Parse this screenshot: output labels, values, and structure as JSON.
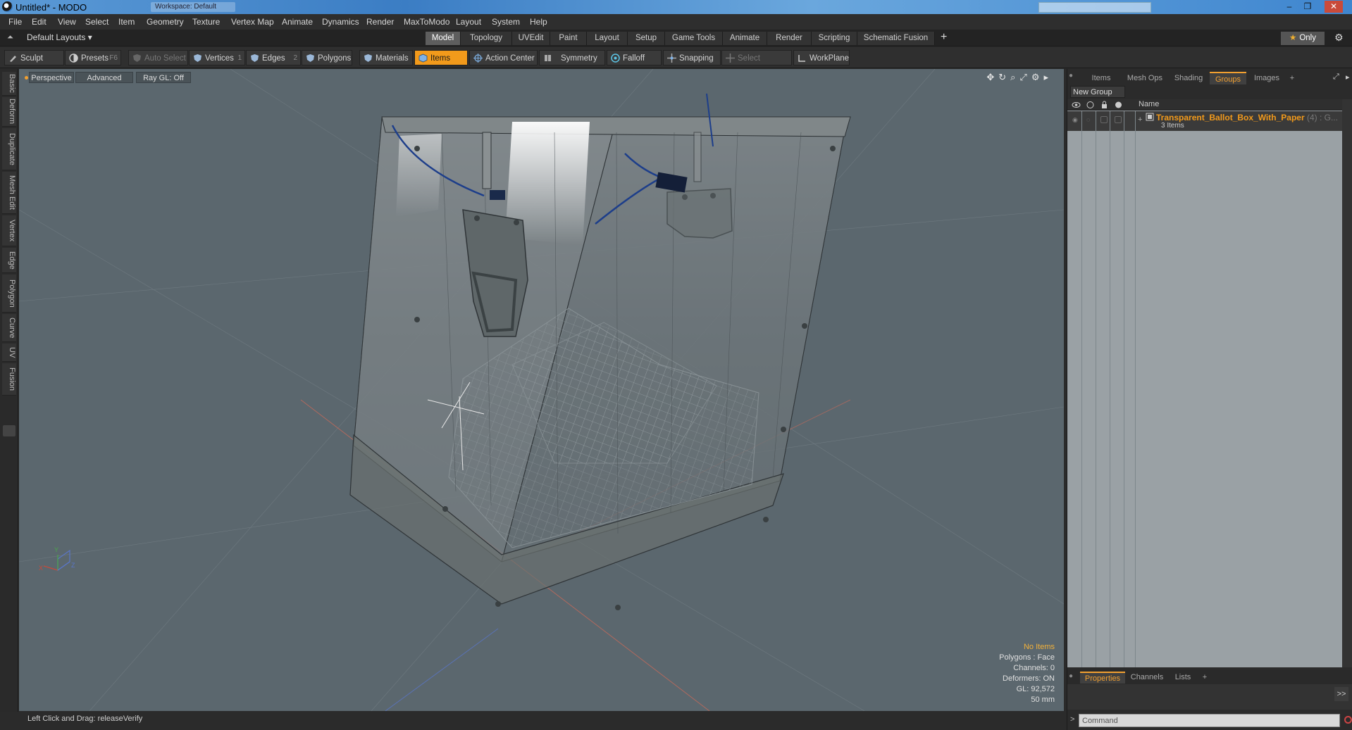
{
  "window": {
    "title": "Untitled* - MODO",
    "ghost_tabs": [
      "Workspace: Default"
    ],
    "controls": [
      "–",
      "❐",
      "✕"
    ]
  },
  "menu": [
    "File",
    "Edit",
    "View",
    "Select",
    "Item",
    "Geometry",
    "Texture",
    "Vertex Map",
    "Animate",
    "Dynamics",
    "Render",
    "MaxToModo",
    "Layout",
    "System",
    "Help"
  ],
  "layouts": {
    "dropdown": "Default Layouts ▾",
    "tabs": [
      "Model",
      "Topology",
      "UVEdit",
      "Paint",
      "Layout",
      "Setup",
      "Game Tools",
      "Animate",
      "Render",
      "Scripting",
      "Schematic Fusion"
    ],
    "active_tab": "Model",
    "add": "+",
    "only_label": "Only"
  },
  "toolbar": {
    "sculpt": "Sculpt",
    "presets": "Presets",
    "presets_key": "F6",
    "auto_select": "Auto Select",
    "vertices": "Vertices",
    "vertices_key": "1",
    "edges": "Edges",
    "edges_key": "2",
    "polygons": "Polygons",
    "materials": "Materials",
    "items": "Items",
    "action_center": "Action Center",
    "symmetry": "Symmetry",
    "falloff": "Falloff",
    "snapping": "Snapping",
    "select_through": "Select Through",
    "workplane": "WorkPlane"
  },
  "left_tabs": [
    "Basic",
    "Deform",
    "Duplicate",
    "Mesh Edit",
    "Vertex",
    "Edge",
    "Polygon",
    "Curve",
    "UV",
    "Fusion"
  ],
  "viewport": {
    "view_mode": "Perspective",
    "shading": "Advanced",
    "raygl": "Ray GL: Off",
    "info": {
      "no_items": "No Items",
      "polygons": "Polygons : Face",
      "channels": "Channels: 0",
      "deformers": "Deformers: ON",
      "gl": "GL: 92,572",
      "unit": "50 mm"
    },
    "axis_labels": [
      "X",
      "Y",
      "Z"
    ]
  },
  "status": {
    "hint": "Left Click and Drag:   releaseVerify"
  },
  "right_panel": {
    "tabs": [
      "Items",
      "Mesh Ops",
      "Shading",
      "Groups",
      "Images"
    ],
    "active_tab": "Groups",
    "add": "+",
    "new_group": "New Group",
    "name_header": "Name",
    "group": {
      "name": "Transparent_Ballot_Box_With_Paper",
      "suffix": "(4) : G...",
      "count": "3 Items"
    },
    "bottom_tabs": [
      "Properties",
      "Channels",
      "Lists"
    ],
    "active_bottom_tab": "Properties",
    "expand": ">>",
    "command_placeholder": "Command",
    "prompt": ">"
  },
  "colors": {
    "accent": "#f29a1b",
    "viewport_bg": "#5b676e",
    "panel_bg": "#2b2b2b"
  }
}
